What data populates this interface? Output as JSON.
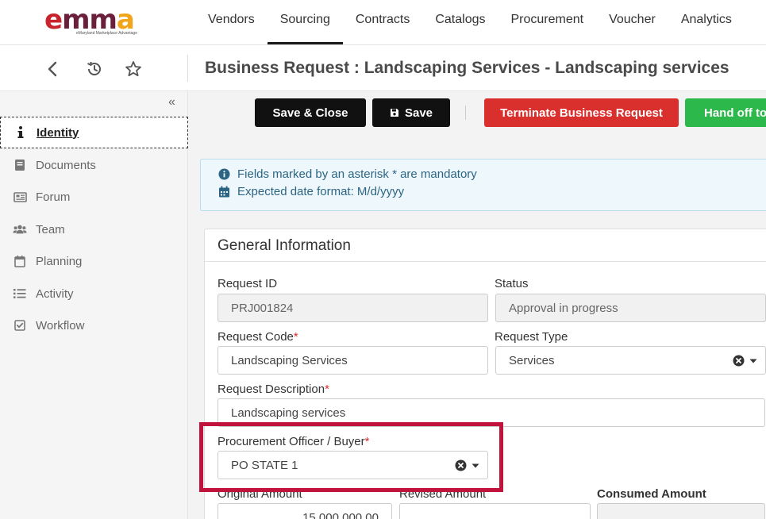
{
  "app": {
    "logo_text": "emma",
    "logo_tagline": "eMaryland Marketplace Advantage"
  },
  "nav": {
    "items": [
      {
        "label": "Vendors"
      },
      {
        "label": "Sourcing"
      },
      {
        "label": "Contracts"
      },
      {
        "label": "Catalogs"
      },
      {
        "label": "Procurement"
      },
      {
        "label": "Voucher"
      },
      {
        "label": "Analytics"
      }
    ],
    "active": "Sourcing"
  },
  "page": {
    "title": "Business Request : Landscaping Services - Landscaping services"
  },
  "sidebar": {
    "items": [
      {
        "label": "Identity",
        "icon": "info-icon"
      },
      {
        "label": "Documents",
        "icon": "book-icon"
      },
      {
        "label": "Forum",
        "icon": "newspaper-icon"
      },
      {
        "label": "Team",
        "icon": "users-icon"
      },
      {
        "label": "Planning",
        "icon": "calendar-icon"
      },
      {
        "label": "Activity",
        "icon": "list-icon"
      },
      {
        "label": "Workflow",
        "icon": "check-square-icon"
      }
    ],
    "active": "Identity"
  },
  "toolbar": {
    "save_close": "Save & Close",
    "save": "Save",
    "terminate": "Terminate Business Request",
    "handoff": "Hand off to"
  },
  "info": {
    "mandatory": "Fields marked by an asterisk * are mandatory",
    "date_format": "Expected date format: M/d/yyyy"
  },
  "general": {
    "title": "General Information",
    "request_id_label": "Request ID",
    "request_id": "PRJ001824",
    "status_label": "Status",
    "status": "Approval in progress",
    "request_code_label": "Request Code",
    "request_code": "Landscaping Services",
    "request_type_label": "Request Type",
    "request_type": "Services",
    "request_description_label": "Request Description",
    "request_description": "Landscaping services",
    "officer_label": "Procurement Officer / Buyer",
    "officer": "PO STATE 1",
    "original_amount_label": "Original Amount",
    "original_amount": "15,000,000.00",
    "revised_amount_label": "Revised Amount",
    "revised_amount": "",
    "consumed_amount_label": "Consumed Amount",
    "consumed_amount": "",
    "required_marker": "*"
  },
  "colors": {
    "accent_red": "#d9302e",
    "accent_green": "#2db84b",
    "highlight": "#c0143c",
    "info_text": "#2c6583"
  }
}
